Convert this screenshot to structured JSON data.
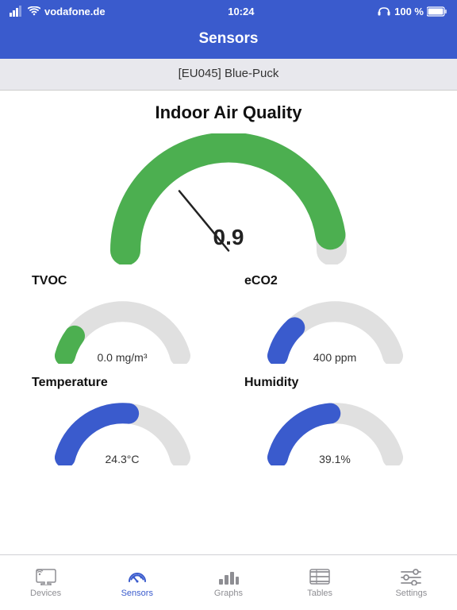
{
  "statusBar": {
    "carrier": "vodafone.de",
    "time": "10:24",
    "battery": "100 %"
  },
  "navBar": {
    "title": "Sensors"
  },
  "breadcrumb": {
    "label": "[EU045] Blue-Puck"
  },
  "mainSection": {
    "title": "Indoor Air Quality",
    "mainGaugeValue": "0.9",
    "sensors": [
      {
        "id": "tvoc",
        "label": "TVOC",
        "value": "0.0 mg/m³",
        "color": "#4caf50",
        "fillPercent": 0.12,
        "position": "left"
      },
      {
        "id": "eco2",
        "label": "eCO2",
        "value": "400 ppm",
        "color": "#3a5bcd",
        "fillPercent": 0.18,
        "position": "right"
      },
      {
        "id": "temperature",
        "label": "Temperature",
        "value": "24.3°C",
        "color": "#3a5bcd",
        "fillPercent": 0.45,
        "position": "left"
      },
      {
        "id": "humidity",
        "label": "Humidity",
        "value": "39.1%",
        "color": "#3a5bcd",
        "fillPercent": 0.39,
        "position": "right"
      }
    ]
  },
  "tabBar": {
    "tabs": [
      {
        "id": "devices",
        "label": "Devices",
        "active": false
      },
      {
        "id": "sensors",
        "label": "Sensors",
        "active": true
      },
      {
        "id": "graphs",
        "label": "Graphs",
        "active": false
      },
      {
        "id": "tables",
        "label": "Tables",
        "active": false
      },
      {
        "id": "settings",
        "label": "Settings",
        "active": false
      }
    ]
  }
}
